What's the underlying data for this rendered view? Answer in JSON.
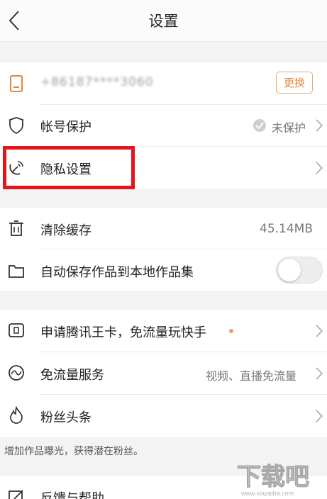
{
  "header": {
    "title": "设置"
  },
  "account": {
    "phone": "+86187****3060",
    "change_label": "更换"
  },
  "rows": {
    "account_protect": {
      "label": "帐号保护",
      "status": "未保护"
    },
    "privacy": {
      "label": "隐私设置"
    },
    "clear_cache": {
      "label": "清除缓存",
      "size": "45.14MB"
    },
    "auto_save": {
      "label": "自动保存作品到本地作品集",
      "enabled": false
    },
    "tencent_card": {
      "label": "申请腾讯王卡，免流量玩快手"
    },
    "free_data": {
      "label": "免流量服务",
      "value": "视频、直播免流量"
    },
    "fan_headline": {
      "label": "粉丝头条"
    },
    "feedback": {
      "label": "反馈与帮助"
    }
  },
  "fan_note": "增加作品曝光，获得潜在粉丝。",
  "watermark": {
    "text": "下载吧",
    "url": "www.xiazaiba.com"
  },
  "colors": {
    "accent": "#e08a3c",
    "highlight_box": "#e8141a",
    "dot": "#f39a5a"
  },
  "icons": {
    "back": "chevron-left-icon",
    "phone": "phone-icon",
    "shield": "shield-icon",
    "privacy": "satellite-icon",
    "trash": "trash-icon",
    "folder": "folder-icon",
    "sim": "sim-card-icon",
    "wave": "wave-icon",
    "flame": "flame-icon",
    "edit": "edit-icon"
  }
}
